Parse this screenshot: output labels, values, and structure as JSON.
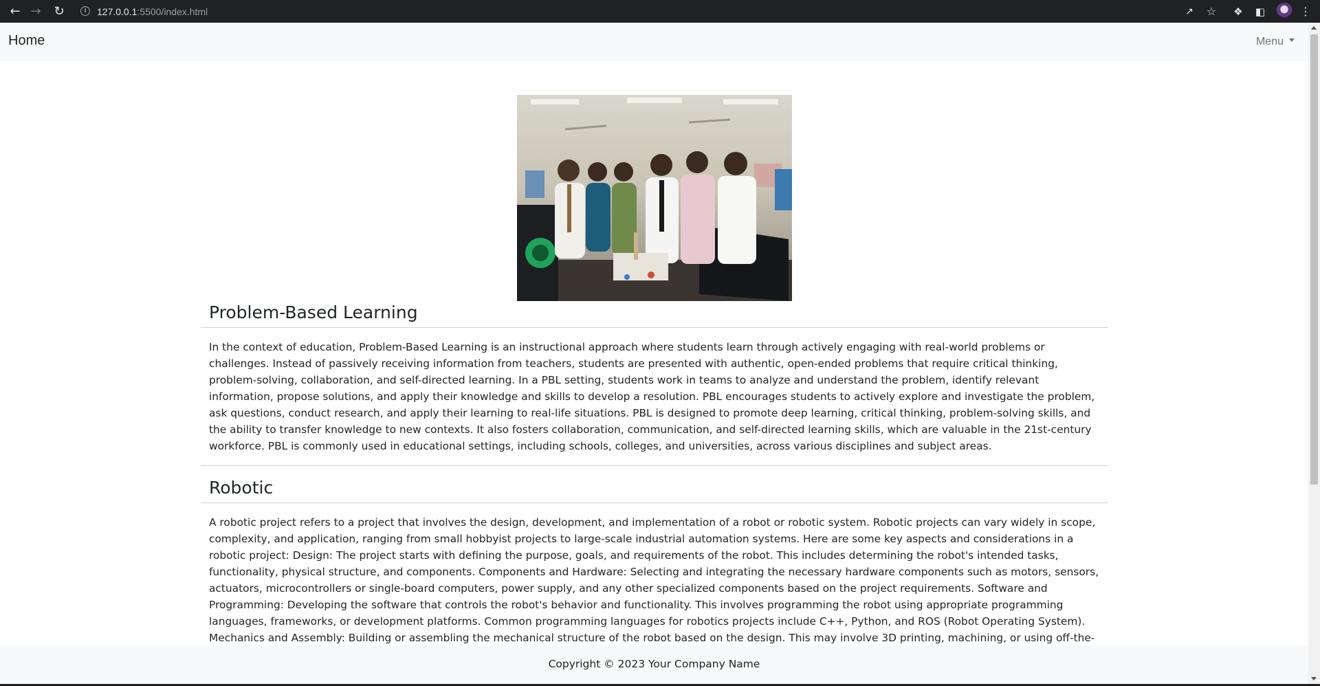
{
  "browser": {
    "url_host": "127.0.0.1",
    "url_rest": ":5500/index.html",
    "back_icon": "arrow-left-icon",
    "forward_icon": "arrow-right-icon",
    "reload_icon": "reload-icon"
  },
  "navbar": {
    "brand": "Home",
    "menu_label": "Menu"
  },
  "hero": {
    "alt": "Team photo of students at a project exhibition"
  },
  "sections": [
    {
      "title": "Problem-Based Learning",
      "body": "In the context of education, Problem-Based Learning is an instructional approach where students learn through actively engaging with real-world problems or challenges. Instead of passively receiving information from teachers, students are presented with authentic, open-ended problems that require critical thinking, problem-solving, collaboration, and self-directed learning. In a PBL setting, students work in teams to analyze and understand the problem, identify relevant information, propose solutions, and apply their knowledge and skills to develop a resolution. PBL encourages students to actively explore and investigate the problem, ask questions, conduct research, and apply their learning to real-life situations. PBL is designed to promote deep learning, critical thinking, problem-solving skills, and the ability to transfer knowledge to new contexts. It also fosters collaboration, communication, and self-directed learning skills, which are valuable in the 21st-century workforce. PBL is commonly used in educational settings, including schools, colleges, and universities, across various disciplines and subject areas."
    },
    {
      "title": "Robotic",
      "body": "A robotic project refers to a project that involves the design, development, and implementation of a robot or robotic system. Robotic projects can vary widely in scope, complexity, and application, ranging from small hobbyist projects to large-scale industrial automation systems. Here are some key aspects and considerations in a robotic project: Design: The project starts with defining the purpose, goals, and requirements of the robot. This includes determining the robot's intended tasks, functionality, physical structure, and components. Components and Hardware: Selecting and integrating the necessary hardware components such as motors, sensors, actuators, microcontrollers or single-board computers, power supply, and any other specialized components based on the project requirements. Software and Programming: Developing the software that controls the robot's behavior and functionality. This involves programming the robot using appropriate programming languages, frameworks, or development platforms. Common programming languages for robotics projects include C++, Python, and ROS (Robot Operating System). Mechanics and Assembly: Building or assembling the mechanical structure of the robot based on the design. This may involve 3D printing, machining, or using off-the-shelf components to create the robot's physical body. Sensing and Perception: Integrating sensors to enable the robot to perceive"
    }
  ],
  "footer": {
    "copyright": "Copyright © 2023 Your Company Name"
  }
}
